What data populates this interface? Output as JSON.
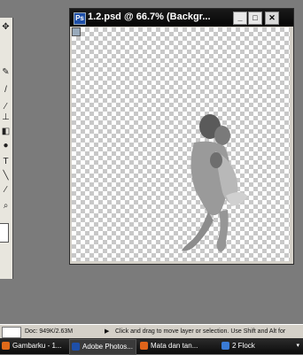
{
  "document_window": {
    "title": "1.2.psd @ 66.7% (Backgr...",
    "minimize": "_",
    "maximize": "□",
    "close": "✕"
  },
  "toolbox": {
    "tools": [
      {
        "name": "move-icon",
        "glyph": "✥"
      },
      {
        "name": "pen-icon",
        "glyph": "✎"
      },
      {
        "name": "pencil-icon",
        "glyph": "/"
      },
      {
        "name": "brush-icon",
        "glyph": "⁄"
      },
      {
        "name": "clone-icon",
        "glyph": "⊥"
      },
      {
        "name": "eraser-icon",
        "glyph": "◧"
      },
      {
        "name": "dodge-icon",
        "glyph": "●"
      },
      {
        "name": "type-icon",
        "glyph": "T"
      },
      {
        "name": "line-icon",
        "glyph": "╲"
      },
      {
        "name": "eyedropper-icon",
        "glyph": "∕"
      },
      {
        "name": "zoom-icon",
        "glyph": "⌕"
      }
    ]
  },
  "statusbar": {
    "doc_info": "Doc: 949K/2.63M",
    "arrow": "▶",
    "hint": "Click and drag to move layer or selection.  Use Shift and Alt for"
  },
  "taskbar": {
    "items": [
      {
        "label": "Gambarku - 1...",
        "icon_color": "#e06a1a"
      },
      {
        "label": "Adobe Photos...",
        "icon_color": "#1e4fa8"
      },
      {
        "label": "Mata dan tan...",
        "icon_color": "#e0641a"
      },
      {
        "label": "2 Flock",
        "icon_color": "#3a7bd5"
      }
    ],
    "more": "▾"
  }
}
